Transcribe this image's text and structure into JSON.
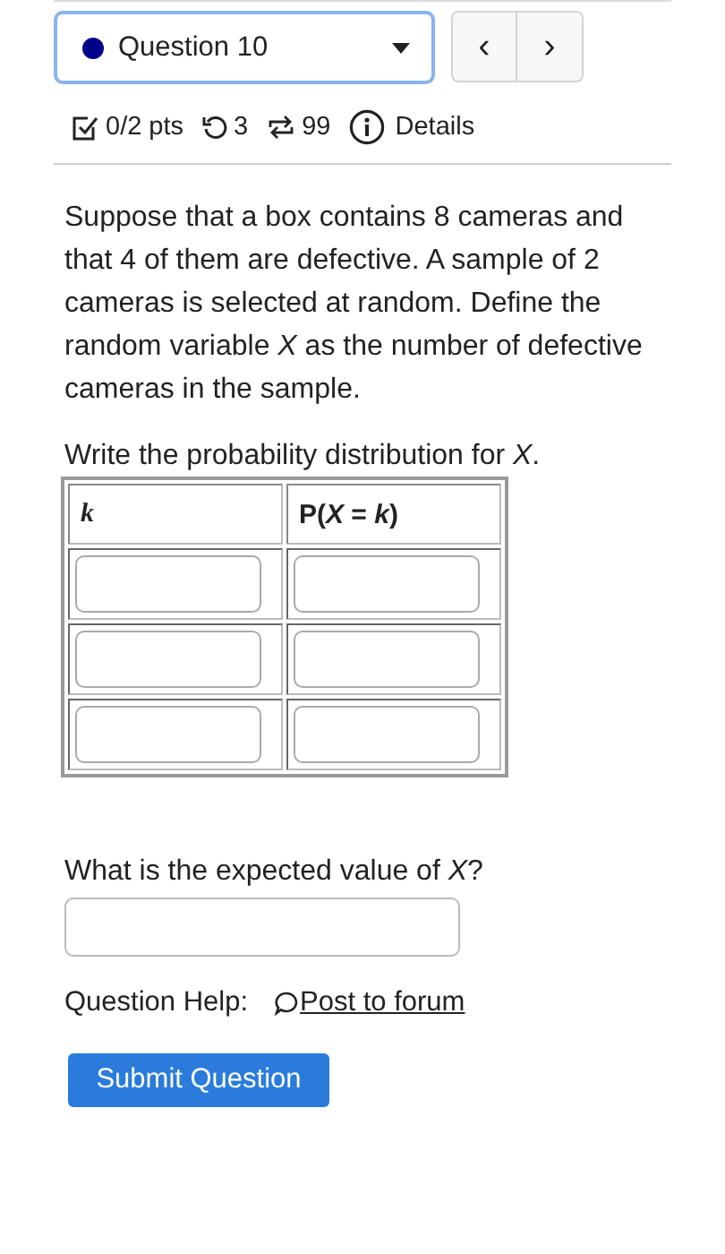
{
  "question_selector": {
    "label": "Question 10"
  },
  "nav_buttons": [
    "‹",
    "›"
  ],
  "stats": {
    "score": "0/2 pts",
    "retries": "3",
    "attempts": "99",
    "details": "Details"
  },
  "question_text": "Suppose that a box contains 8 cameras and that 4 of them are defective. A sample of 2 cameras is selected at random. Define the random variable *X* as the number of defective cameras in the sample.",
  "table_prompt": "Write the probability distribution for *X*.",
  "table": {
    "columns": [
      {
        "label": "k",
        "italic": true
      },
      {
        "label": "P(*X* = *k*)",
        "italic": false
      }
    ],
    "rows": [
      {
        "cells": [
          {
            "kind": "input"
          },
          {
            "kind": "input"
          }
        ]
      },
      {
        "cells": [
          {
            "kind": "input"
          },
          {
            "kind": "input"
          }
        ]
      },
      {
        "cells": [
          {
            "kind": "input"
          },
          {
            "kind": "input"
          }
        ]
      }
    ]
  },
  "expected_prompt": "What is the expected value of *X*?",
  "help": {
    "label": "Question Help:",
    "link": "Post to forum"
  },
  "submit": "Submit Question"
}
